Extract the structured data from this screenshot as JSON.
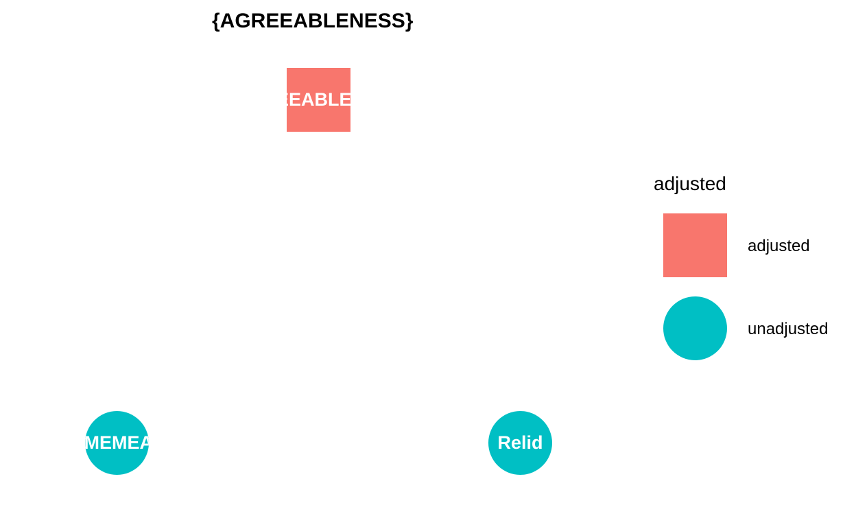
{
  "title": "{AGREEABLENESS}",
  "colors": {
    "adjusted": "#F8766D",
    "unadjusted": "#00BFC4"
  },
  "nodes": [
    {
      "label": "AGREEABLENESS",
      "type": "adjusted",
      "shape": "square"
    },
    {
      "label": "TIMEMEAN",
      "type": "unadjusted",
      "shape": "circle"
    },
    {
      "label": "Relid",
      "type": "unadjusted",
      "shape": "circle"
    }
  ],
  "legend": {
    "title": "adjusted",
    "items": [
      {
        "label": "adjusted",
        "shape": "square"
      },
      {
        "label": "unadjusted",
        "shape": "circle"
      }
    ]
  }
}
